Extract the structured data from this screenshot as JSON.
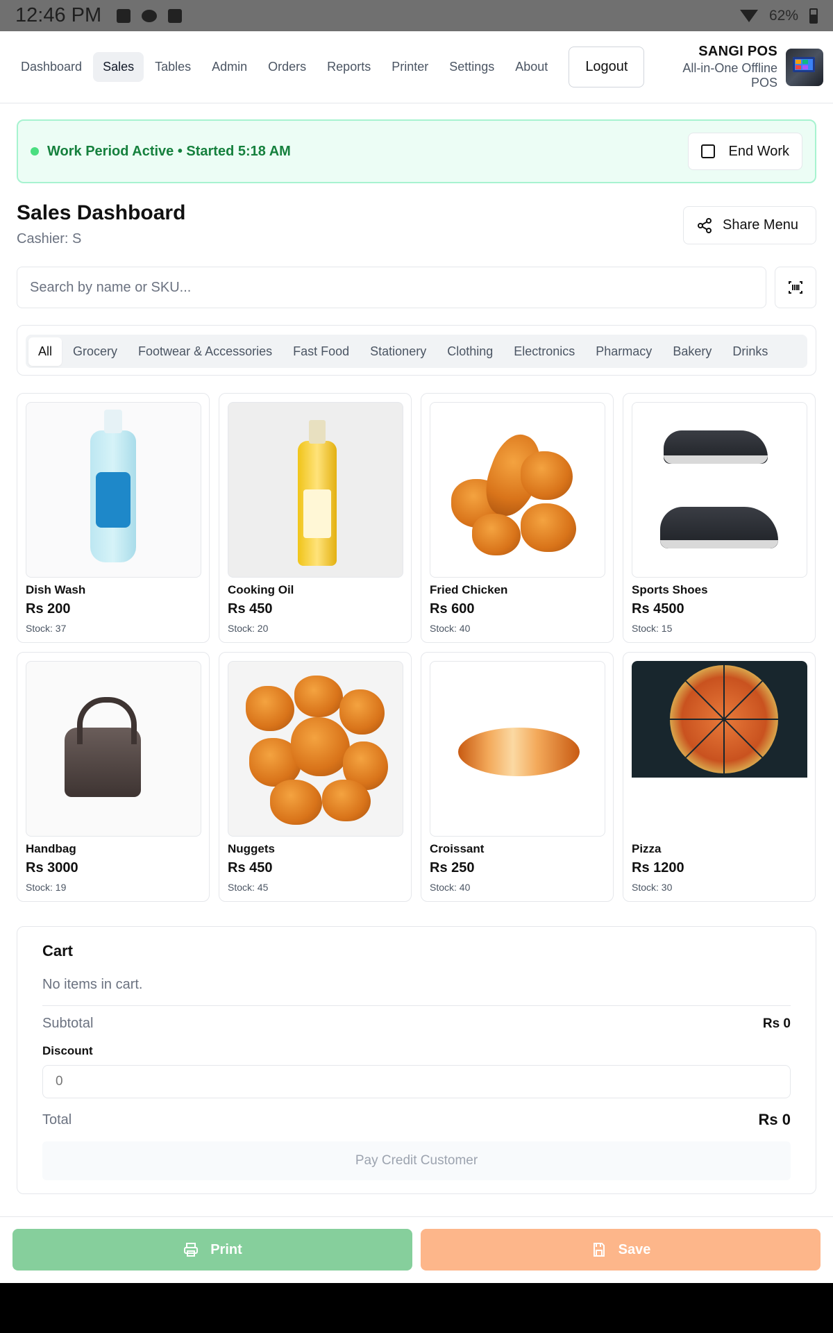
{
  "status_bar": {
    "time": "12:46 PM",
    "battery": "62%"
  },
  "nav": {
    "items": [
      "Dashboard",
      "Sales",
      "Tables",
      "Admin",
      "Orders",
      "Reports",
      "Printer",
      "Settings",
      "About"
    ],
    "active": "Sales",
    "logout_label": "Logout",
    "brand_name": "SANGI POS",
    "brand_sub": "All-in-One Offline POS"
  },
  "work_banner": {
    "text": "Work Period Active • Started 5:18 AM",
    "end_label": "End Work"
  },
  "header": {
    "title": "Sales Dashboard",
    "cashier": "Cashier: S",
    "share_label": "Share Menu"
  },
  "search": {
    "placeholder": "Search by name or SKU..."
  },
  "categories": [
    "All",
    "Grocery",
    "Footwear & Accessories",
    "Fast Food",
    "Stationery",
    "Clothing",
    "Electronics",
    "Pharmacy",
    "Bakery",
    "Drinks"
  ],
  "products": [
    {
      "name": "Dish Wash",
      "price": "Rs 200",
      "stock": "Stock: 37"
    },
    {
      "name": "Cooking Oil",
      "price": "Rs 450",
      "stock": "Stock: 20"
    },
    {
      "name": "Fried Chicken",
      "price": "Rs 600",
      "stock": "Stock: 40"
    },
    {
      "name": "Sports Shoes",
      "price": "Rs 4500",
      "stock": "Stock: 15"
    },
    {
      "name": "Handbag",
      "price": "Rs 3000",
      "stock": "Stock: 19"
    },
    {
      "name": "Nuggets",
      "price": "Rs 450",
      "stock": "Stock: 45"
    },
    {
      "name": "Croissant",
      "price": "Rs 250",
      "stock": "Stock: 40"
    },
    {
      "name": "Pizza",
      "price": "Rs 1200",
      "stock": "Stock: 30"
    }
  ],
  "cart": {
    "title": "Cart",
    "empty": "No items in cart.",
    "subtotal_label": "Subtotal",
    "subtotal_value": "Rs 0",
    "discount_label": "Discount",
    "discount_placeholder": "0",
    "total_label": "Total",
    "total_value": "Rs 0",
    "pay_credit_label": "Pay Credit Customer"
  },
  "actions": {
    "print_label": "Print",
    "save_label": "Save"
  },
  "colors": {
    "accent_green": "#15803d",
    "print_button": "#86cf9c",
    "save_button": "#fdb68a"
  }
}
